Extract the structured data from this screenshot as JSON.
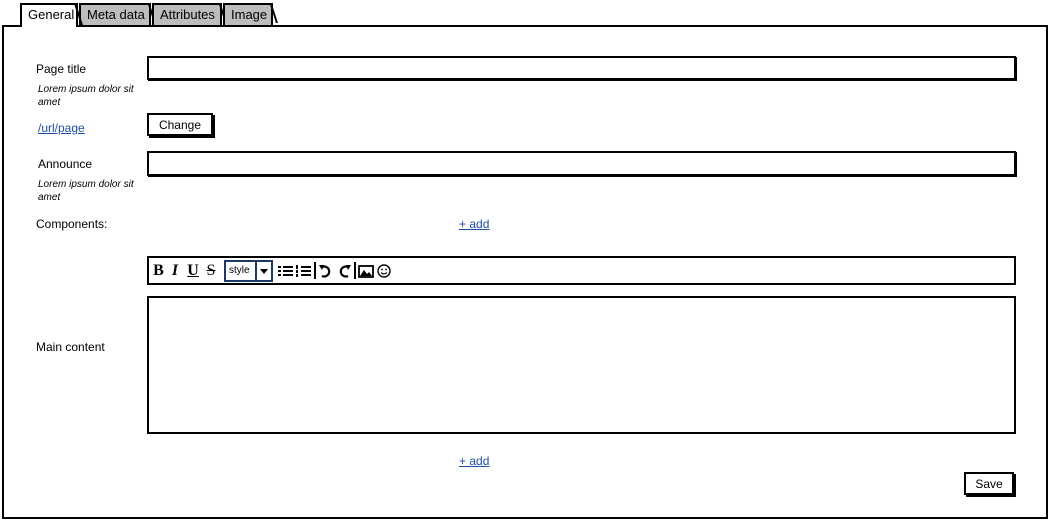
{
  "tabs": [
    {
      "label": "General"
    },
    {
      "label": "Meta data"
    },
    {
      "label": "Attributes"
    },
    {
      "label": "Image"
    }
  ],
  "form": {
    "page_title_label": "Page title",
    "page_title_hint": "Lorem ipsum dolor sit amet",
    "page_title_value": "",
    "url_link": "/url/page",
    "change_button": "Change",
    "announce_label": "Announce",
    "announce_hint": "Lorem ipsum dolor sit amet",
    "announce_value": "",
    "components_label": "Components:",
    "add_link_1": "+ add",
    "main_content_label": "Main content",
    "add_link_2": "+ add",
    "save_button": "Save"
  },
  "toolbar": {
    "bold": "B",
    "italic": "I",
    "underline": "U",
    "strike": "S",
    "style_select": "style",
    "icons": [
      "bullet-list-icon",
      "numbered-list-icon",
      "undo-icon",
      "redo-icon",
      "image-icon",
      "smiley-icon"
    ]
  },
  "colors": {
    "link": "#1f4fa6",
    "inactive_tab": "#bdbdbd",
    "select_border": "#1b3b66"
  }
}
